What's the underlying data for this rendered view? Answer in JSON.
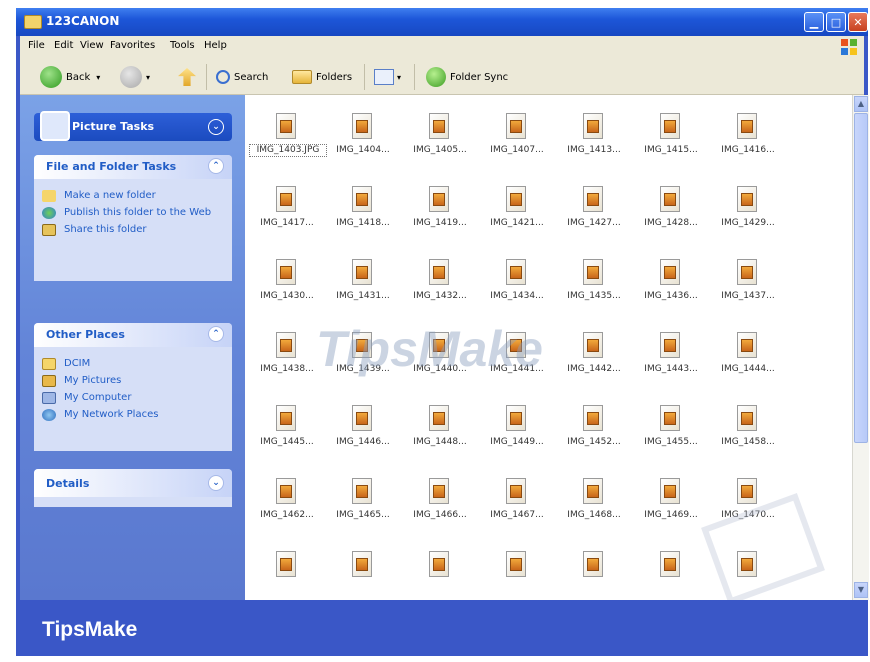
{
  "window": {
    "title": "123CANON",
    "minimize_label": "▁",
    "maximize_label": "□",
    "close_label": "✕"
  },
  "menubar": {
    "items": [
      "File",
      "Edit",
      "View",
      "Favorites",
      "Tools",
      "Help"
    ]
  },
  "toolbar": {
    "back_label": "Back",
    "search_label": "Search",
    "folders_label": "Folders",
    "folder_sync_label": "Folder Sync"
  },
  "left_pane": {
    "picture_tasks": {
      "title": "Picture Tasks",
      "chevron": "⌄"
    },
    "file_folder_tasks": {
      "title": "File and Folder Tasks",
      "chevron": "⌃",
      "items": [
        "Make a new folder",
        "Publish this folder to the Web",
        "Share this folder"
      ]
    },
    "other_places": {
      "title": "Other Places",
      "chevron": "⌃",
      "items": [
        "DCIM",
        "My Pictures",
        "My Computer",
        "My Network Places"
      ]
    },
    "details": {
      "title": "Details",
      "chevron": "⌄"
    }
  },
  "files": {
    "rows": [
      [
        "IMG_1403.JPG",
        "IMG_1404...",
        "IMG_1405...",
        "IMG_1407...",
        "IMG_1413...",
        "IMG_1415...",
        "IMG_1416..."
      ],
      [
        "IMG_1417...",
        "IMG_1418...",
        "IMG_1419...",
        "IMG_1421...",
        "IMG_1427...",
        "IMG_1428...",
        "IMG_1429..."
      ],
      [
        "IMG_1430...",
        "IMG_1431...",
        "IMG_1432...",
        "IMG_1434...",
        "IMG_1435...",
        "IMG_1436...",
        "IMG_1437..."
      ],
      [
        "IMG_1438...",
        "IMG_1439...",
        "IMG_1440...",
        "IMG_1441...",
        "IMG_1442...",
        "IMG_1443...",
        "IMG_1444..."
      ],
      [
        "IMG_1445...",
        "IMG_1446...",
        "IMG_1448...",
        "IMG_1449...",
        "IMG_1452...",
        "IMG_1455...",
        "IMG_1458..."
      ],
      [
        "IMG_1462...",
        "IMG_1465...",
        "IMG_1466...",
        "IMG_1467...",
        "IMG_1468...",
        "IMG_1469...",
        "IMG_1470..."
      ],
      [
        "",
        "",
        "",
        "",
        "",
        "",
        ""
      ]
    ],
    "selected": "IMG_1403.JPG"
  },
  "scrollbar": {
    "up": "▲",
    "down": "▼"
  },
  "watermark": {
    "text": "TipsMake"
  },
  "footer": {
    "brand": "TipsMake"
  },
  "colors": {
    "titlebar": "#1d56d8",
    "task_pane": "#6385d8",
    "footer": "#3a57c7"
  }
}
